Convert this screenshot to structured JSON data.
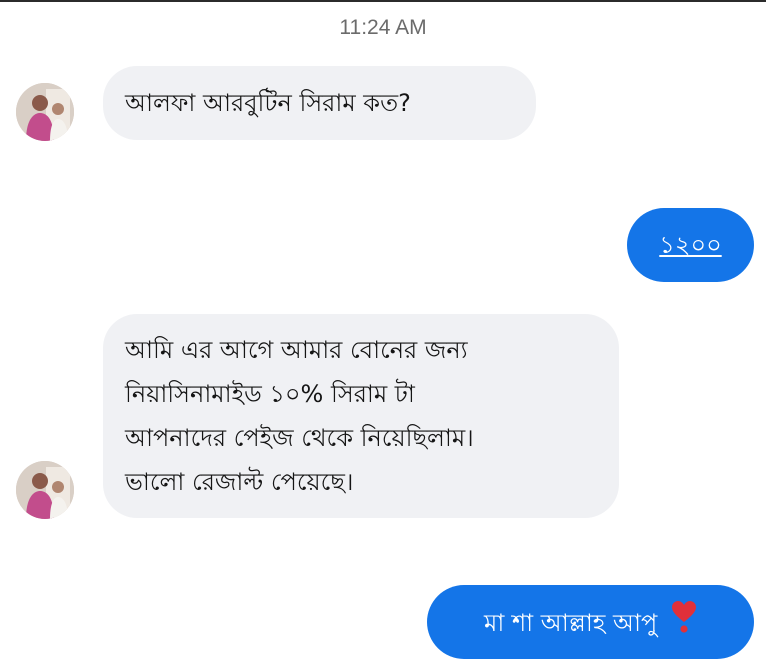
{
  "chat": {
    "timestamp": "11:24 AM",
    "messages": [
      {
        "direction": "incoming",
        "text": "আলফা আরবুটিন সিরাম কত?"
      },
      {
        "direction": "outgoing",
        "text": "১২০০"
      },
      {
        "direction": "incoming",
        "lines": [
          "আমি এর আগে আমার বোনের জন্য",
          "নিয়াসিনামাইড ১০% সিরাম টা",
          "আপনাদের পেইজ থেকে নিয়েছিলাম।",
          "ভালো রেজাল্ট পেয়েছে।"
        ]
      },
      {
        "direction": "outgoing",
        "text": "মা শা আল্লাহ আপু",
        "emoji": "heart-exclamation-icon"
      }
    ]
  },
  "colors": {
    "outgoing_bubble": "#1475e8",
    "incoming_bubble": "#f0f1f4",
    "timestamp_text": "#6b6b6b",
    "heart": "#e0303a"
  }
}
